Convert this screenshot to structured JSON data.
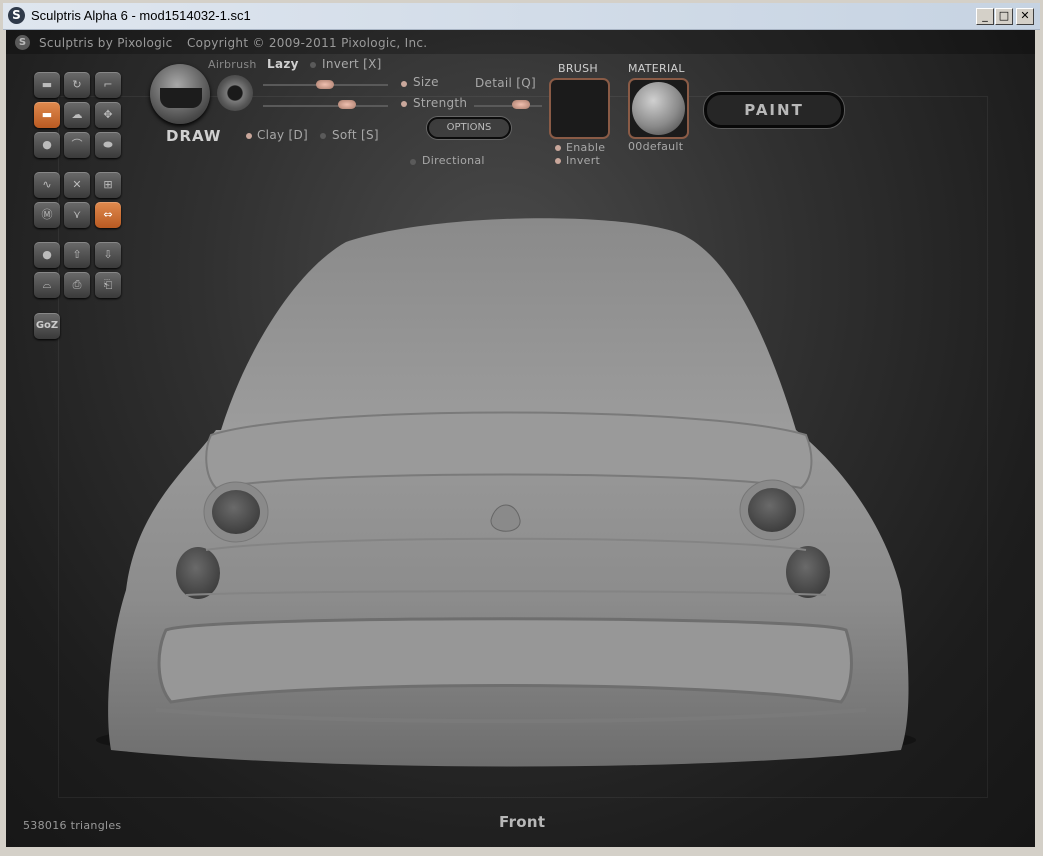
{
  "window": {
    "title": "Sculptris Alpha 6 - mod1514032-1.sc1",
    "buttons": {
      "minimize": "_",
      "maximize": "□",
      "close": "✕"
    }
  },
  "header": {
    "brand": "Sculptris by Pixologic",
    "copyright": "Copyright © 2009-2011 Pixologic, Inc."
  },
  "toolbar": {
    "groups": [
      [
        "draw-tool",
        "rotate-tool",
        "crop-tool",
        "flatten-tool",
        "inflate-tool",
        "grab-tool",
        "pinch-tool",
        "crease-tool",
        "smooth-tool"
      ],
      [
        "symmetry-tool",
        "wireframe-tool",
        "grid-tool",
        "mask-tool",
        "reduce-tool",
        "mirror-tool"
      ],
      [
        "sphere-tool",
        "import-obj-tool",
        "export-obj-tool",
        "plane-tool",
        "save-tool",
        "load-tool"
      ]
    ],
    "goz_label": "GoZ"
  },
  "brush_panel": {
    "tool_name": "DRAW",
    "airbrush": "Airbrush",
    "lazy": "Lazy",
    "invert": "Invert [X]",
    "size": "Size",
    "strength": "Strength",
    "detail": "Detail [Q]",
    "options": "OPTIONS",
    "clay": "Clay [D]",
    "soft": "Soft [S]",
    "directional": "Directional",
    "brush_title": "BRUSH",
    "brush_enable": "Enable",
    "brush_invert": "Invert",
    "material_title": "MATERIAL",
    "material_name": "00default",
    "paint": "PAINT"
  },
  "viewport": {
    "view_name": "Front",
    "triangle_count": "538016 triangles"
  }
}
